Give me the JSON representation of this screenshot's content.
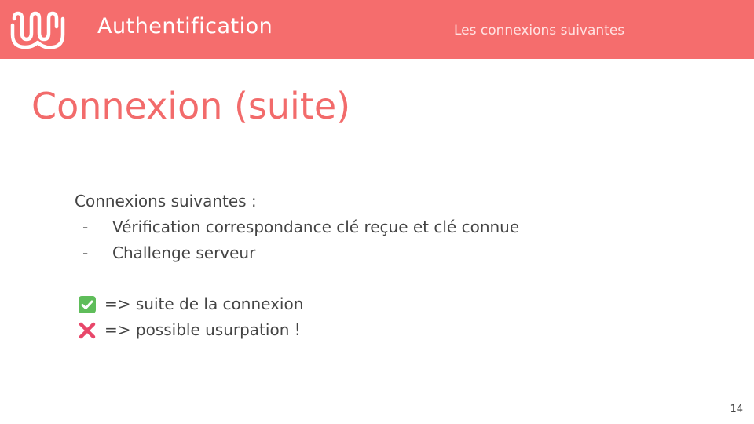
{
  "header": {
    "title": "Authentification",
    "subtitle": "Les connexions suivantes",
    "logo_icon": "wave-logo-icon",
    "background_color": "#f56d6d"
  },
  "slide": {
    "title": "Connexion (suite)",
    "title_color": "#f26b6b",
    "intro": "Connexions suivantes :",
    "bullets": [
      {
        "marker": "-",
        "text": "Vérification correspondance clé reçue et clé connue"
      },
      {
        "marker": "-",
        "text": "Challenge serveur"
      }
    ],
    "outcomes": [
      {
        "icon": "check-mark-icon",
        "text": "=> suite de la connexion",
        "color": "#5fbd5a"
      },
      {
        "icon": "cross-mark-icon",
        "text": "=> possible usurpation !",
        "color": "#e8476a"
      }
    ]
  },
  "footer": {
    "page_number": "14"
  }
}
